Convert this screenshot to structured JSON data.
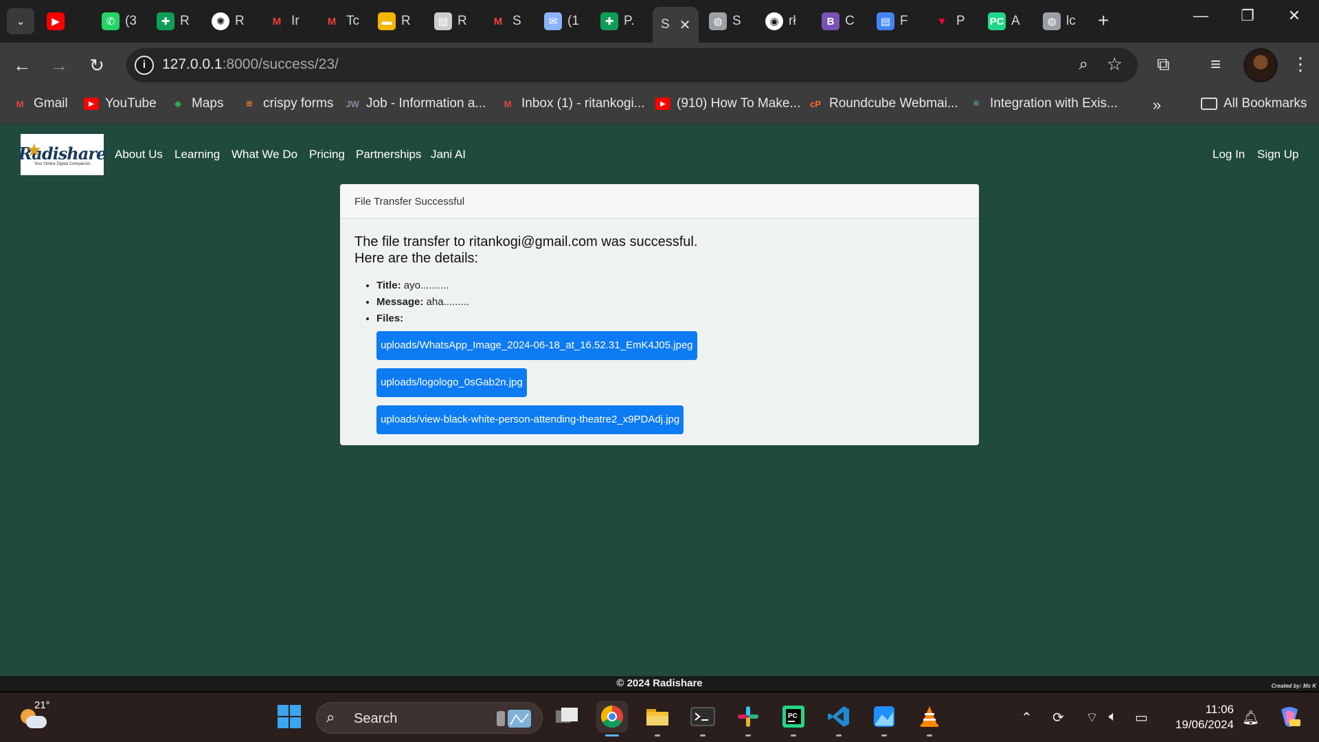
{
  "browser": {
    "tabs": [
      {
        "name": "tab-youtube",
        "label": "",
        "icon": "youtube-icon",
        "color": "#ff0000"
      },
      {
        "name": "tab-whatsapp",
        "label": "(3",
        "icon": "whatsapp-icon",
        "color": "#25d366"
      },
      {
        "name": "tab-sheets-1",
        "label": "R",
        "icon": "google-sheets-icon",
        "color": "#0f9d58"
      },
      {
        "name": "tab-chatgpt",
        "label": "R",
        "icon": "chatgpt-icon",
        "color": "#ffffff"
      },
      {
        "name": "tab-gmail-1",
        "label": "Ir",
        "icon": "gmail-icon",
        "color": "#ea4335"
      },
      {
        "name": "tab-gmail-2",
        "label": "Tc",
        "icon": "gmail-icon",
        "color": "#ea4335"
      },
      {
        "name": "tab-slides",
        "label": "R",
        "icon": "google-slides-icon",
        "color": "#f4b400"
      },
      {
        "name": "tab-docs",
        "label": "R",
        "icon": "document-icon",
        "color": "#cccccc"
      },
      {
        "name": "tab-gmail-3",
        "label": "S",
        "icon": "gmail-icon",
        "color": "#ea4335"
      },
      {
        "name": "tab-inbox",
        "label": "(1",
        "icon": "inbox-icon",
        "color": "#8ab4f8"
      },
      {
        "name": "tab-sheets-2",
        "label": "P.",
        "icon": "google-sheets-icon",
        "color": "#0f9d58"
      },
      {
        "name": "tab-active",
        "label": "S",
        "icon": "",
        "color": "#3c3c3c"
      },
      {
        "name": "tab-globe-1",
        "label": "S",
        "icon": "globe-icon",
        "color": "#9aa0a6"
      },
      {
        "name": "tab-github",
        "label": "rł",
        "icon": "github-icon",
        "color": "#ffffff"
      },
      {
        "name": "tab-bootstrap",
        "label": "C",
        "icon": "bootstrap-icon",
        "color": "#7952b3"
      },
      {
        "name": "tab-forms",
        "label": "F",
        "icon": "forms-icon",
        "color": "#4285f4"
      },
      {
        "name": "tab-vercel",
        "label": "P",
        "icon": "triangle-icon",
        "color": "#ff0033"
      },
      {
        "name": "tab-pycharm",
        "label": "A",
        "icon": "pycharm-icon",
        "color": "#21d789"
      },
      {
        "name": "tab-globe-2",
        "label": "lc",
        "icon": "globe-icon",
        "color": "#9aa0a6"
      }
    ],
    "url_host": "127.0.0.1",
    "url_rest": ":8000/success/23/",
    "bookmarks": [
      {
        "label": "Gmail",
        "icon": "gmail-icon",
        "color": "#ea4335"
      },
      {
        "label": "YouTube",
        "icon": "youtube-icon",
        "color": "#ff0000"
      },
      {
        "label": "Maps",
        "icon": "maps-icon",
        "color": "#34a853"
      },
      {
        "label": "crispy forms",
        "icon": "stack-icon",
        "color": "#f48024"
      },
      {
        "label": "Job - Information a...",
        "icon": "job-site-icon",
        "color": "#8a8aa8"
      },
      {
        "label": "Inbox (1) - ritankogi...",
        "icon": "gmail-icon",
        "color": "#ea4335"
      },
      {
        "label": "(910) How To Make...",
        "icon": "youtube-icon",
        "color": "#ff0000"
      },
      {
        "label": "Roundcube Webmai...",
        "icon": "cpanel-icon",
        "color": "#ff6c2c"
      },
      {
        "label": "Integration with Exis...",
        "icon": "react-icon",
        "color": "#61dafb"
      }
    ],
    "all_bookmarks": "All Bookmarks"
  },
  "site": {
    "logo_text": "Radishare",
    "logo_tagline": "Your Online Digital Companion",
    "nav": [
      "About Us",
      "Learning",
      "What We Do",
      "Pricing",
      "Partnerships",
      "Jani AI"
    ],
    "auth": [
      "Log In",
      "Sign Up"
    ],
    "card_header": "File Transfer Successful",
    "headline_1": "The file transfer to ritankogi@gmail.com was successful.",
    "headline_2": "Here are the details:",
    "title_label": "Title:",
    "title_value": "ayo..........",
    "message_label": "Message:",
    "message_value": "aha.........",
    "files_label": "Files:",
    "files": [
      "uploads/WhatsApp_Image_2024-06-18_at_16.52.31_EmK4J05.jpeg",
      "uploads/logologo_0sGab2n.jpg",
      "uploads/view-black-white-person-attending-theatre2_x9PDAdj.jpg"
    ],
    "footer": "© 2024 Radishare",
    "footer_credit": "Created by: Ms K"
  },
  "taskbar": {
    "temperature": "21°",
    "search_label": "Search",
    "time": "11:06",
    "date": "19/06/2024",
    "accent_color": "#5fb2ff"
  }
}
